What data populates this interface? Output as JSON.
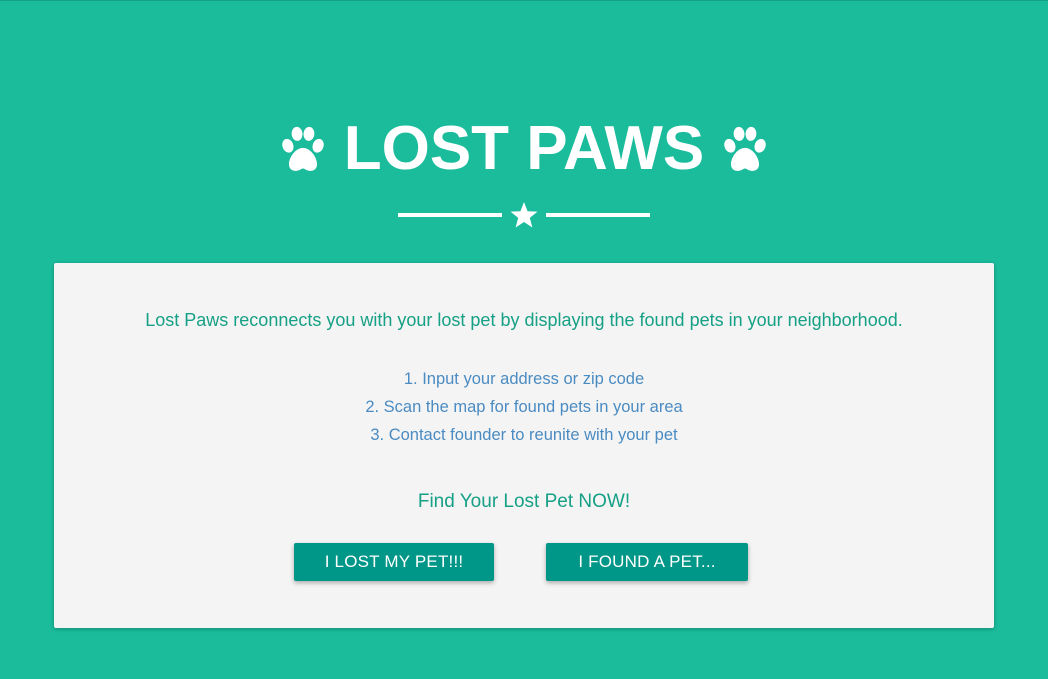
{
  "header": {
    "title": "LOST PAWS",
    "left_icon": "paw-icon",
    "right_icon": "paw-icon",
    "divider_icon": "star-icon"
  },
  "card": {
    "intro": "Lost Paws reconnects you with your lost pet by displaying the found pets in your neighborhood.",
    "steps": [
      "1. Input your address or zip code",
      "2. Scan the map for found pets in your area",
      "3. Contact founder to reunite with your pet"
    ],
    "cta": "Find Your Lost Pet NOW!",
    "lost_button_label": "I LOST MY PET!!!",
    "found_button_label": "I FOUND A PET..."
  },
  "colors": {
    "background": "#1abc9c",
    "card": "#f4f4f4",
    "accent_text": "#16a085",
    "steps_text": "#4a8bc2",
    "button": "#009688"
  }
}
